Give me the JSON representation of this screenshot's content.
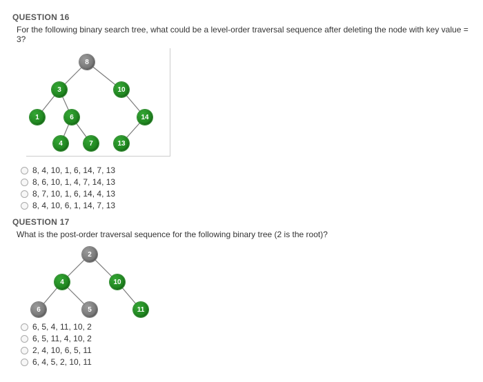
{
  "q16": {
    "title": "QUESTION 16",
    "prompt": "For the following binary search tree, what could be a level-order traversal sequence after deleting the node with key value = 3?",
    "nodes": {
      "n8": "8",
      "n3": "3",
      "n10": "10",
      "n1": "1",
      "n6": "6",
      "n14": "14",
      "n4": "4",
      "n7": "7",
      "n13": "13"
    },
    "options": {
      "a": "8, 4, 10, 1, 6, 14, 7, 13",
      "b": "8, 6, 10, 1, 4, 7, 14, 13",
      "c": "8, 7, 10, 1, 6, 14, 4, 13",
      "d": "8, 4, 10, 6, 1, 14, 7, 13"
    }
  },
  "q17": {
    "title": "QUESTION 17",
    "prompt": "What is the post-order traversal sequence for the following binary tree (2 is the root)?",
    "nodes": {
      "n2": "2",
      "n4": "4",
      "n10": "10",
      "n6": "6",
      "n5": "5",
      "n11": "11"
    },
    "options": {
      "a": "6, 5, 4, 11, 10, 2",
      "b": "6, 5, 11, 4, 10, 2",
      "c": "2, 4, 10, 6, 5, 11",
      "d": "6, 4, 5, 2, 10, 11"
    }
  }
}
